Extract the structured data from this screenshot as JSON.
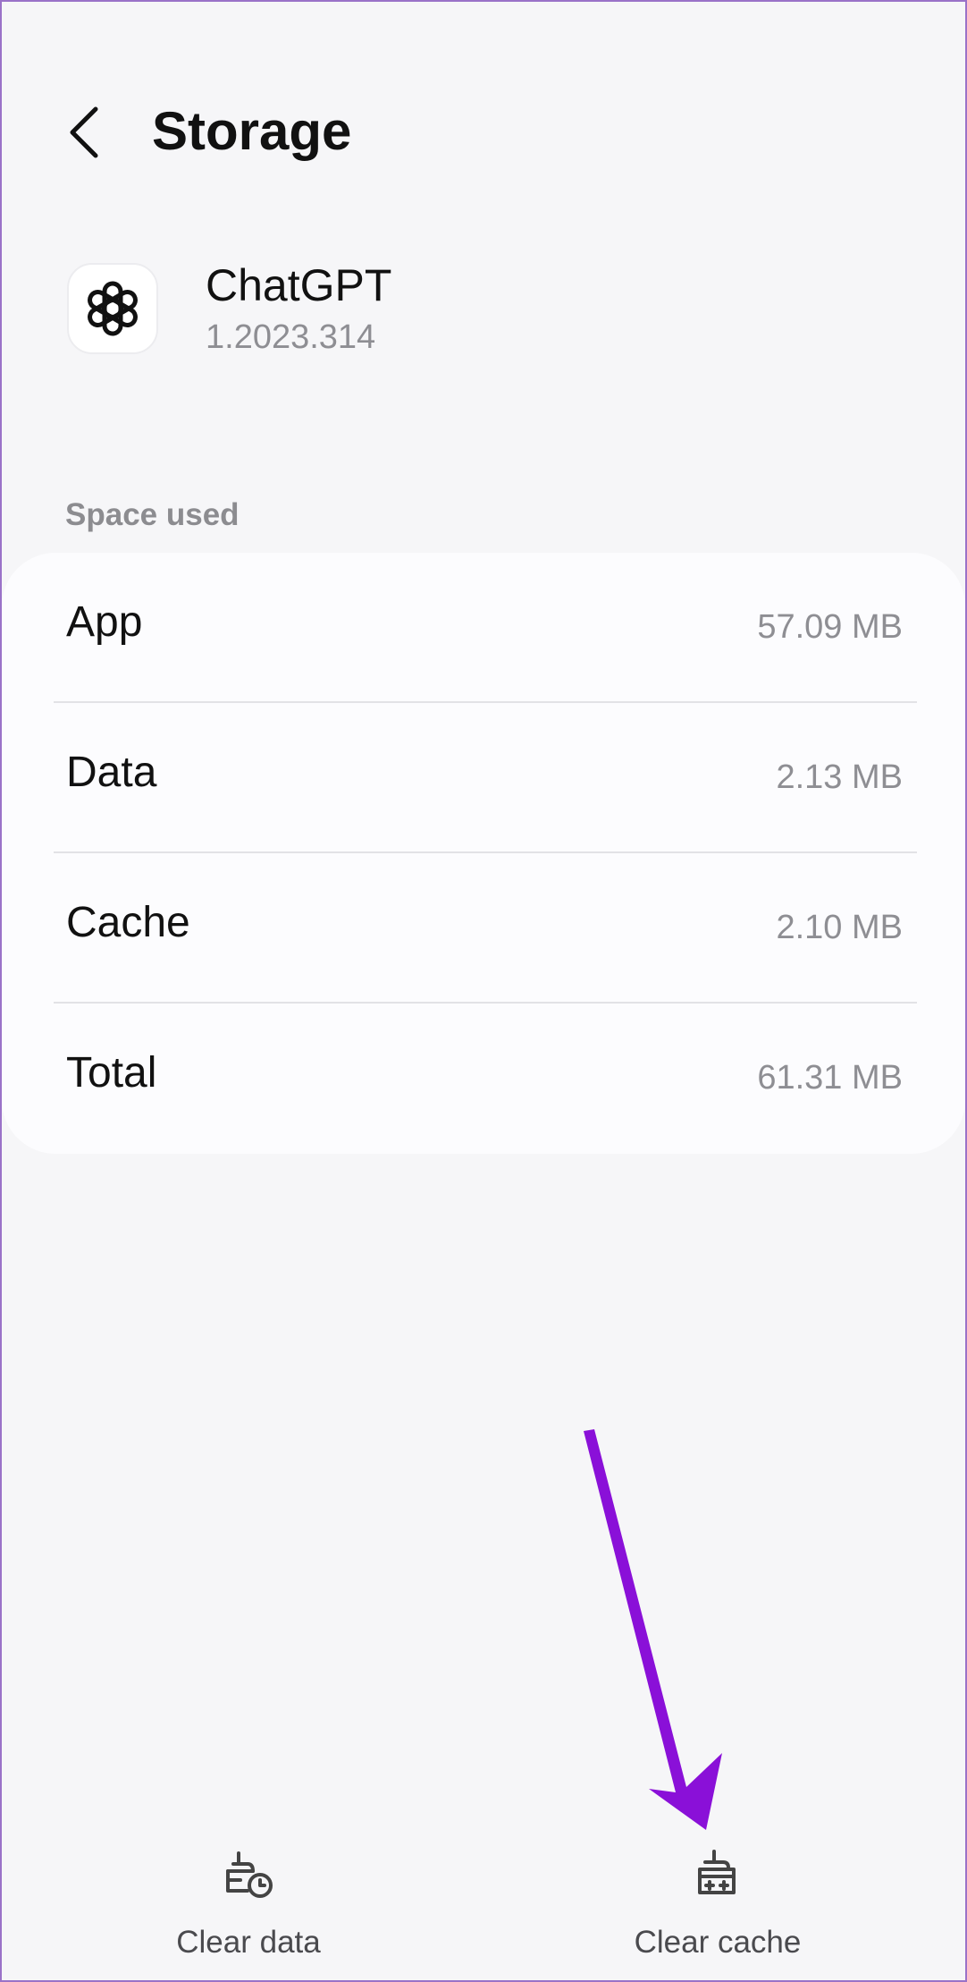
{
  "header": {
    "title": "Storage",
    "back_icon": "chevron-left-icon"
  },
  "app": {
    "name": "ChatGPT",
    "version": "1.2023.314",
    "icon": "openai-logo-icon"
  },
  "space_used": {
    "label": "Space used",
    "rows": [
      {
        "label": "App",
        "value": "57.09 MB"
      },
      {
        "label": "Data",
        "value": "2.13 MB"
      },
      {
        "label": "Cache",
        "value": "2.10 MB"
      },
      {
        "label": "Total",
        "value": "61.31 MB"
      }
    ]
  },
  "actions": {
    "clear_data": {
      "label": "Clear data",
      "icon": "clear-data-icon"
    },
    "clear_cache": {
      "label": "Clear cache",
      "icon": "clear-cache-icon"
    }
  },
  "colors": {
    "background": "#f6f6f8",
    "card": "#fcfcfe",
    "annotation_arrow": "#8a10d8",
    "secondary_text": "#8e8e93"
  }
}
